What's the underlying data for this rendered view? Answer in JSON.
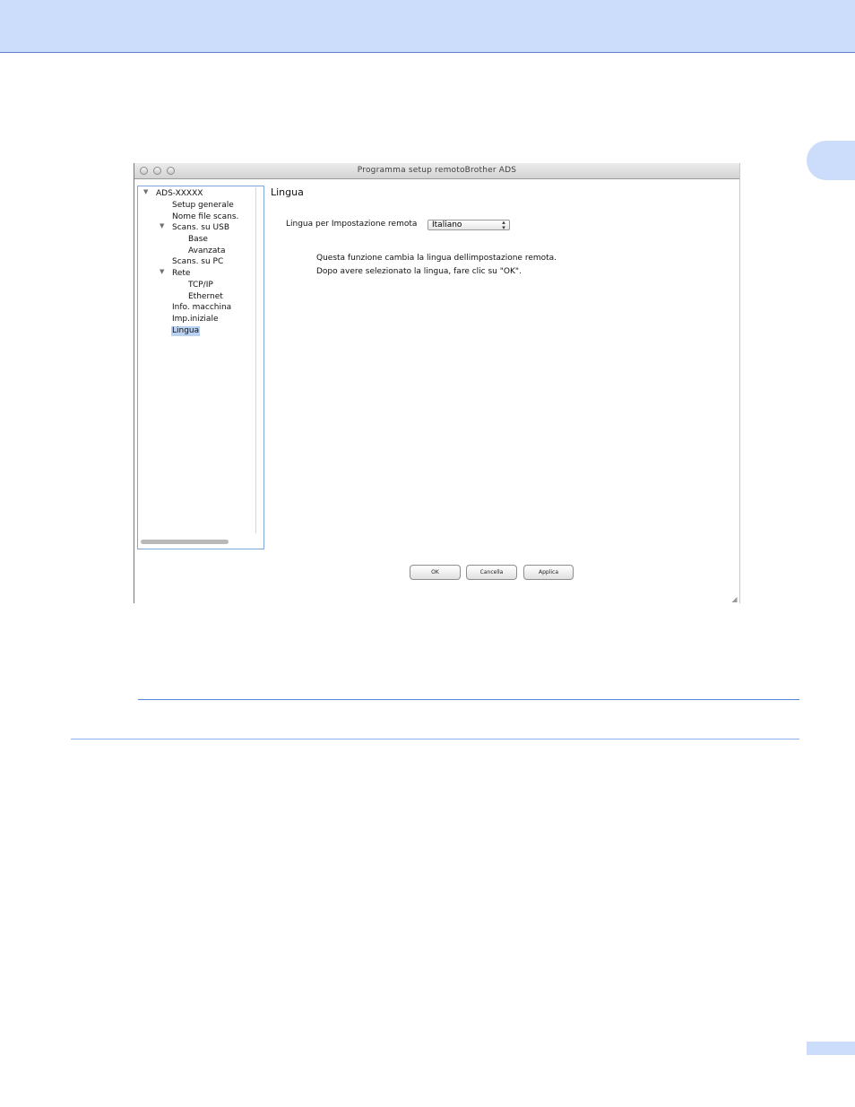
{
  "window": {
    "title": "Programma setup remotoBrother ADS"
  },
  "sidebar": {
    "items": [
      {
        "label": "ADS-XXXXX",
        "expanded": true
      },
      {
        "label": "Setup generale"
      },
      {
        "label": "Nome file scans."
      },
      {
        "label": "Scans. su USB",
        "expanded": true
      },
      {
        "label": "Base"
      },
      {
        "label": "Avanzata"
      },
      {
        "label": "Scans. su PC"
      },
      {
        "label": "Rete",
        "expanded": true
      },
      {
        "label": "TCP/IP"
      },
      {
        "label": "Ethernet"
      },
      {
        "label": "Info. macchina"
      },
      {
        "label": "Imp.iniziale"
      },
      {
        "label": "Lingua",
        "selected": true
      }
    ]
  },
  "main": {
    "section_title": "Lingua",
    "language_label": "Lingua per Impostazione remota",
    "language_select": {
      "selected": "Italiano"
    },
    "description_lines": [
      "Questa funzione cambia la lingua dellimpostazione remota.",
      "Dopo avere selezionato la lingua, fare clic su \"OK\"."
    ]
  },
  "buttons": {
    "ok": "OK",
    "cancel": "Cancella",
    "apply": "Applica"
  },
  "colors": {
    "header_band": "#ccdcfb",
    "selection": "#b9d1f3",
    "rule": "#4f86e0"
  }
}
